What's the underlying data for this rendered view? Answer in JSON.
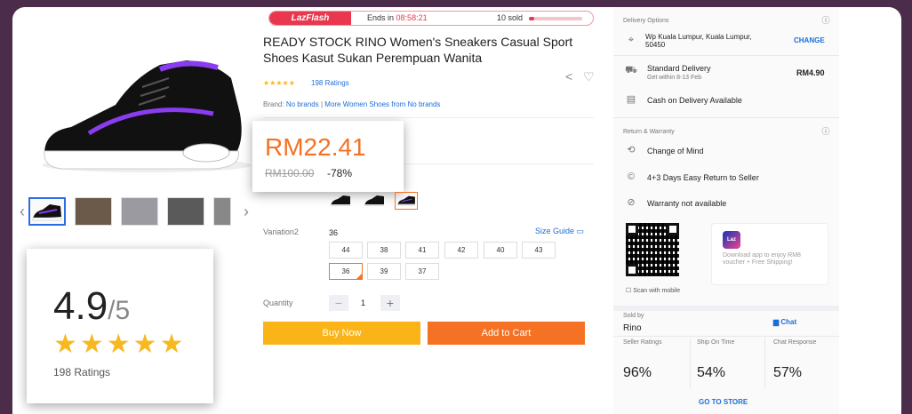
{
  "flash": {
    "logo": "LazFlash",
    "ends_label": "Ends in",
    "ends_time": "08:58:21",
    "sold": "10 sold",
    "progress": 0.1
  },
  "product": {
    "title": "READY STOCK RINO Women's Sneakers Casual Sport Shoes Kasut Sukan Perempuan Wanita",
    "stars": "★★★★★",
    "ratings_link": "198 Ratings",
    "brand_label": "Brand:",
    "brand_value": "No brands",
    "brand_sep": "|",
    "brand_more": "More Women Shoes from No brands"
  },
  "price": {
    "current": "RM22.41",
    "original": "RM100.00",
    "discount": "-78%"
  },
  "rating_card": {
    "value": "4.9",
    "out_of": "/5",
    "stars": "★★★★★",
    "count": "198 Ratings"
  },
  "variation2": {
    "label": "Variation2",
    "selected": "36",
    "size_guide": "Size Guide",
    "sizes_row1": [
      "44",
      "38",
      "41",
      "42",
      "40",
      "43"
    ],
    "sizes_row2": [
      "36",
      "39",
      "37"
    ]
  },
  "quantity": {
    "label": "Quantity",
    "minus": "−",
    "value": "1",
    "plus": "+"
  },
  "actions": {
    "buy_now": "Buy Now",
    "add_to_cart": "Add to Cart"
  },
  "delivery": {
    "title": "Delivery Options",
    "location": "Wp Kuala Lumpur, Kuala Lumpur, 50450",
    "change": "CHANGE",
    "standard": "Standard Delivery",
    "standard_sub": "Get within 8-13 Feb",
    "standard_price": "RM4.90",
    "cod": "Cash on Delivery Available"
  },
  "warranty": {
    "title": "Return & Warranty",
    "items": [
      "Change of Mind",
      "4+3 Days Easy Return to Seller",
      "Warranty not available"
    ]
  },
  "app": {
    "scan_label": "Scan with mobile",
    "laz_logo": "Laz",
    "promo": "Download app to enjoy RM8 voucher + Free Shipping!"
  },
  "seller": {
    "sold_by_label": "Sold by",
    "name": "Rino",
    "chat": "Chat",
    "stats": [
      {
        "label": "Seller Ratings",
        "value": "96%"
      },
      {
        "label": "Ship On Time",
        "value": "54%"
      },
      {
        "label": "Chat Response",
        "value": "57%"
      }
    ],
    "go_to_store": "GO TO STORE"
  },
  "icons": {
    "info": "info-icon",
    "location": "location-pin-icon",
    "truck": "truck-icon",
    "cash": "cash-icon",
    "return": "return-icon",
    "warranty": "shield-off-icon",
    "share": "share-icon",
    "heart": "heart-icon",
    "chat": "chat-icon"
  },
  "colors": {
    "accent": "#f57224",
    "buy": "#fbb418",
    "link": "#1a6ed8",
    "star": "#f8b820",
    "flash": "#e8374f"
  }
}
